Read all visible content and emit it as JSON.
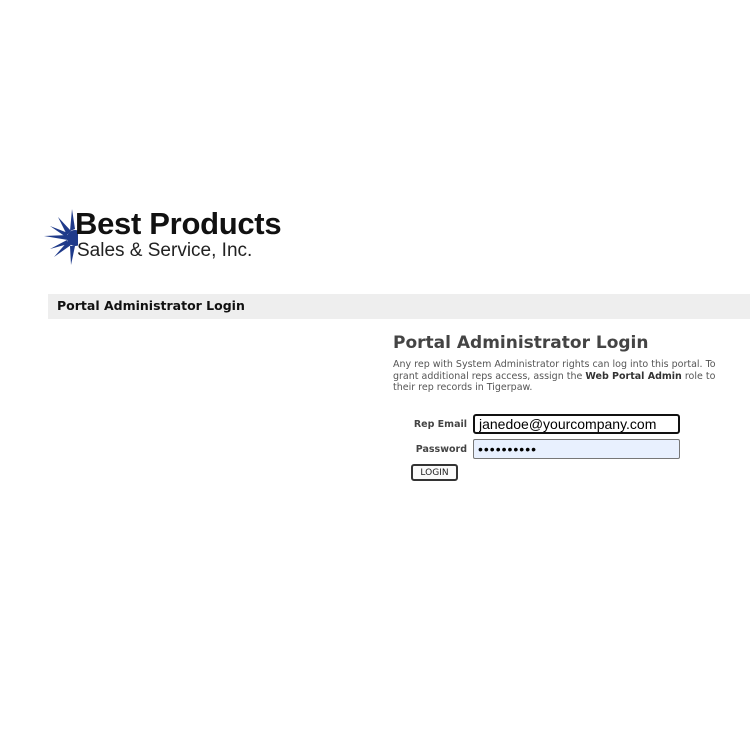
{
  "logo": {
    "name": "Best Products",
    "subtitle": "Sales & Service, Inc.",
    "star_color": "#1f3a8a"
  },
  "header": {
    "title": "Portal Administrator Login"
  },
  "login": {
    "heading": "Portal Administrator Login",
    "description_part1": "Any rep with System Administrator rights can log into this portal. To grant additional reps access, assign the ",
    "description_bold": "Web Portal Admin",
    "description_part2": " role to their rep records in Tigerpaw.",
    "email_label": "Rep Email",
    "email_value": "janedoe@yourcompany.com",
    "password_label": "Password",
    "password_value": "••••••••••",
    "button_label": "LOGIN"
  },
  "colors": {
    "header_bar": "#eeeeee",
    "password_autofill_bg": "#e8f0fe"
  }
}
